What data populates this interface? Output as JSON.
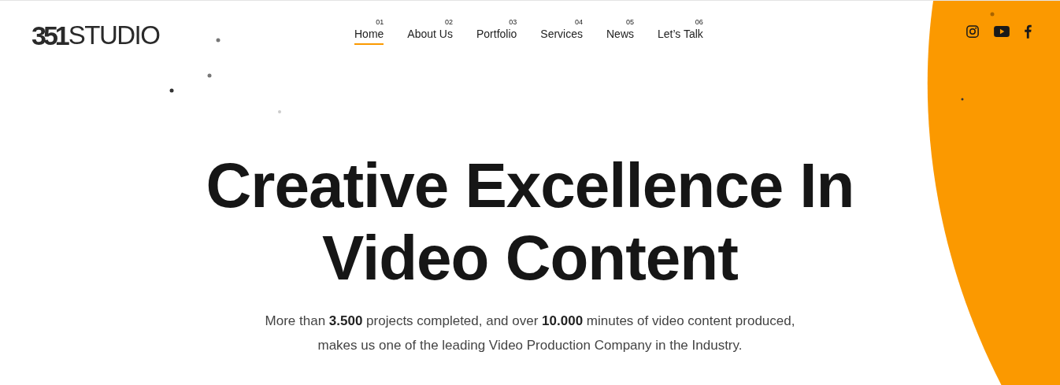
{
  "logo": {
    "mark": "351",
    "name": "STUDIO"
  },
  "nav": [
    {
      "number": "01",
      "label": "Home",
      "selected": true
    },
    {
      "number": "02",
      "label": "About Us",
      "selected": false
    },
    {
      "number": "03",
      "label": "Portfolio",
      "selected": false
    },
    {
      "number": "04",
      "label": "Services",
      "selected": false
    },
    {
      "number": "05",
      "label": "News",
      "selected": false
    },
    {
      "number": "06",
      "label": "Let’s Talk",
      "selected": false
    }
  ],
  "social": [
    {
      "kind": "instagram"
    },
    {
      "kind": "youtube"
    },
    {
      "kind": "facebook"
    }
  ],
  "hero": {
    "title_lines": [
      "Creative Excellence In",
      "Video Content"
    ],
    "subtitle_lines": [
      "More than **3.500** projects completed, and over **10.000** minutes of video content produced,",
      "makes us one of the leading Video Production Company in the Industry."
    ]
  }
}
